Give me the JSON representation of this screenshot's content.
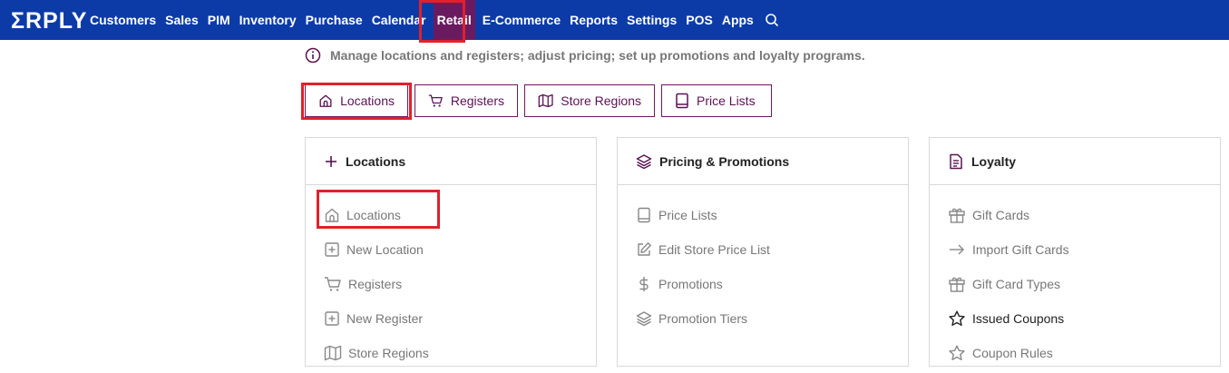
{
  "brand": {
    "logo_text": "ΣRPLY"
  },
  "nav": {
    "items": [
      {
        "label": "Customers"
      },
      {
        "label": "Sales"
      },
      {
        "label": "PIM"
      },
      {
        "label": "Inventory"
      },
      {
        "label": "Purchase"
      },
      {
        "label": "Calendar"
      },
      {
        "label": "Retail",
        "active": true
      },
      {
        "label": "E-Commerce"
      },
      {
        "label": "Reports"
      },
      {
        "label": "Settings"
      },
      {
        "label": "POS"
      },
      {
        "label": "Apps"
      }
    ],
    "search_icon": "search-icon"
  },
  "info": {
    "text": "Manage locations and registers; adjust pricing; set up promotions and loyalty programs."
  },
  "tabs": [
    {
      "label": "Locations",
      "icon": "home-icon"
    },
    {
      "label": "Registers",
      "icon": "cart-icon"
    },
    {
      "label": "Store Regions",
      "icon": "map-icon"
    },
    {
      "label": "Price Lists",
      "icon": "book-icon"
    }
  ],
  "cards": {
    "locations": {
      "title": "Locations",
      "items": [
        {
          "label": "Locations",
          "icon": "home-icon"
        },
        {
          "label": "New Location",
          "icon": "plus-square-icon"
        },
        {
          "label": "Registers",
          "icon": "cart-icon"
        },
        {
          "label": "New Register",
          "icon": "plus-square-icon"
        },
        {
          "label": "Store Regions",
          "icon": "map-icon"
        }
      ]
    },
    "pricing": {
      "title": "Pricing & Promotions",
      "items": [
        {
          "label": "Price Lists",
          "icon": "book-icon"
        },
        {
          "label": "Edit Store Price List",
          "icon": "edit-icon"
        },
        {
          "label": "Promotions",
          "icon": "dollar-icon"
        },
        {
          "label": "Promotion Tiers",
          "icon": "layers-icon"
        }
      ]
    },
    "loyalty": {
      "title": "Loyalty",
      "items": [
        {
          "label": "Gift Cards",
          "icon": "gift-icon"
        },
        {
          "label": "Import Gift Cards",
          "icon": "arrow-right-icon"
        },
        {
          "label": "Gift Card Types",
          "icon": "gift-icon"
        },
        {
          "label": "Issued Coupons",
          "icon": "star-icon"
        },
        {
          "label": "Coupon Rules",
          "icon": "star-icon"
        }
      ]
    }
  },
  "colors": {
    "nav_bg": "#0c3ba8",
    "nav_active": "#6a1b60",
    "accent": "#5a1352",
    "highlight": "#e0212b"
  }
}
